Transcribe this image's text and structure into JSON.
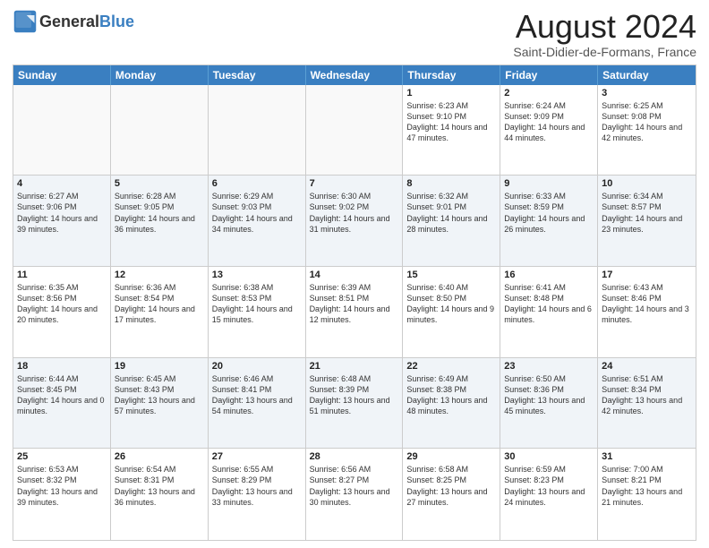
{
  "header": {
    "logo_general": "General",
    "logo_blue": "Blue",
    "month_title": "August 2024",
    "location": "Saint-Didier-de-Formans, France"
  },
  "weekdays": [
    "Sunday",
    "Monday",
    "Tuesday",
    "Wednesday",
    "Thursday",
    "Friday",
    "Saturday"
  ],
  "weeks": [
    [
      {
        "day": "",
        "info": ""
      },
      {
        "day": "",
        "info": ""
      },
      {
        "day": "",
        "info": ""
      },
      {
        "day": "",
        "info": ""
      },
      {
        "day": "1",
        "info": "Sunrise: 6:23 AM\nSunset: 9:10 PM\nDaylight: 14 hours and 47 minutes."
      },
      {
        "day": "2",
        "info": "Sunrise: 6:24 AM\nSunset: 9:09 PM\nDaylight: 14 hours and 44 minutes."
      },
      {
        "day": "3",
        "info": "Sunrise: 6:25 AM\nSunset: 9:08 PM\nDaylight: 14 hours and 42 minutes."
      }
    ],
    [
      {
        "day": "4",
        "info": "Sunrise: 6:27 AM\nSunset: 9:06 PM\nDaylight: 14 hours and 39 minutes."
      },
      {
        "day": "5",
        "info": "Sunrise: 6:28 AM\nSunset: 9:05 PM\nDaylight: 14 hours and 36 minutes."
      },
      {
        "day": "6",
        "info": "Sunrise: 6:29 AM\nSunset: 9:03 PM\nDaylight: 14 hours and 34 minutes."
      },
      {
        "day": "7",
        "info": "Sunrise: 6:30 AM\nSunset: 9:02 PM\nDaylight: 14 hours and 31 minutes."
      },
      {
        "day": "8",
        "info": "Sunrise: 6:32 AM\nSunset: 9:01 PM\nDaylight: 14 hours and 28 minutes."
      },
      {
        "day": "9",
        "info": "Sunrise: 6:33 AM\nSunset: 8:59 PM\nDaylight: 14 hours and 26 minutes."
      },
      {
        "day": "10",
        "info": "Sunrise: 6:34 AM\nSunset: 8:57 PM\nDaylight: 14 hours and 23 minutes."
      }
    ],
    [
      {
        "day": "11",
        "info": "Sunrise: 6:35 AM\nSunset: 8:56 PM\nDaylight: 14 hours and 20 minutes."
      },
      {
        "day": "12",
        "info": "Sunrise: 6:36 AM\nSunset: 8:54 PM\nDaylight: 14 hours and 17 minutes."
      },
      {
        "day": "13",
        "info": "Sunrise: 6:38 AM\nSunset: 8:53 PM\nDaylight: 14 hours and 15 minutes."
      },
      {
        "day": "14",
        "info": "Sunrise: 6:39 AM\nSunset: 8:51 PM\nDaylight: 14 hours and 12 minutes."
      },
      {
        "day": "15",
        "info": "Sunrise: 6:40 AM\nSunset: 8:50 PM\nDaylight: 14 hours and 9 minutes."
      },
      {
        "day": "16",
        "info": "Sunrise: 6:41 AM\nSunset: 8:48 PM\nDaylight: 14 hours and 6 minutes."
      },
      {
        "day": "17",
        "info": "Sunrise: 6:43 AM\nSunset: 8:46 PM\nDaylight: 14 hours and 3 minutes."
      }
    ],
    [
      {
        "day": "18",
        "info": "Sunrise: 6:44 AM\nSunset: 8:45 PM\nDaylight: 14 hours and 0 minutes."
      },
      {
        "day": "19",
        "info": "Sunrise: 6:45 AM\nSunset: 8:43 PM\nDaylight: 13 hours and 57 minutes."
      },
      {
        "day": "20",
        "info": "Sunrise: 6:46 AM\nSunset: 8:41 PM\nDaylight: 13 hours and 54 minutes."
      },
      {
        "day": "21",
        "info": "Sunrise: 6:48 AM\nSunset: 8:39 PM\nDaylight: 13 hours and 51 minutes."
      },
      {
        "day": "22",
        "info": "Sunrise: 6:49 AM\nSunset: 8:38 PM\nDaylight: 13 hours and 48 minutes."
      },
      {
        "day": "23",
        "info": "Sunrise: 6:50 AM\nSunset: 8:36 PM\nDaylight: 13 hours and 45 minutes."
      },
      {
        "day": "24",
        "info": "Sunrise: 6:51 AM\nSunset: 8:34 PM\nDaylight: 13 hours and 42 minutes."
      }
    ],
    [
      {
        "day": "25",
        "info": "Sunrise: 6:53 AM\nSunset: 8:32 PM\nDaylight: 13 hours and 39 minutes."
      },
      {
        "day": "26",
        "info": "Sunrise: 6:54 AM\nSunset: 8:31 PM\nDaylight: 13 hours and 36 minutes."
      },
      {
        "day": "27",
        "info": "Sunrise: 6:55 AM\nSunset: 8:29 PM\nDaylight: 13 hours and 33 minutes."
      },
      {
        "day": "28",
        "info": "Sunrise: 6:56 AM\nSunset: 8:27 PM\nDaylight: 13 hours and 30 minutes."
      },
      {
        "day": "29",
        "info": "Sunrise: 6:58 AM\nSunset: 8:25 PM\nDaylight: 13 hours and 27 minutes."
      },
      {
        "day": "30",
        "info": "Sunrise: 6:59 AM\nSunset: 8:23 PM\nDaylight: 13 hours and 24 minutes."
      },
      {
        "day": "31",
        "info": "Sunrise: 7:00 AM\nSunset: 8:21 PM\nDaylight: 13 hours and 21 minutes."
      }
    ]
  ],
  "alt_rows": [
    1,
    3
  ]
}
